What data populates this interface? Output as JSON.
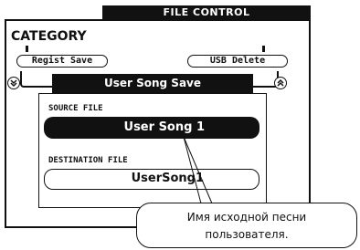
{
  "header": {
    "title": "FILE CONTROL"
  },
  "screen": {
    "category_label": "CATEGORY",
    "soft_buttons": {
      "left": "Regist Save",
      "right": "USB Delete"
    },
    "icons": {
      "left": "scroll-down-icon",
      "right": "scroll-up-icon"
    }
  },
  "panel": {
    "title": "User Song Save",
    "source": {
      "label": "SOURCE FILE",
      "value": "User Song 1"
    },
    "destination": {
      "label": "DESTINATION FILE",
      "value": "UserSong1"
    }
  },
  "callout": {
    "line1": "Имя исходной песни",
    "line2": "пользователя."
  }
}
